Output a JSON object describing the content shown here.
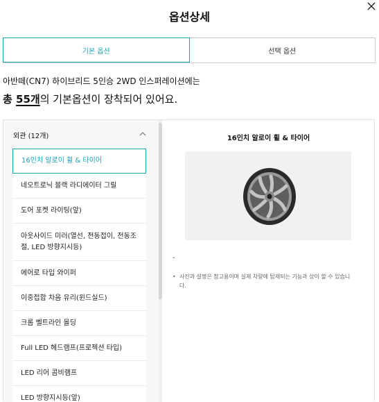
{
  "title": "옵션상세",
  "tabs": [
    {
      "label": "기본 옵션",
      "active": true
    },
    {
      "label": "선택 옵션",
      "active": false
    }
  ],
  "desc_line1": "아반떼(CN7) 하이브리드 5인승 2WD 인스퍼레이션에는",
  "desc_line2": {
    "prefix": "총 ",
    "count": "55개",
    "suffix": "의 기본옵션이 장착되어 있어요."
  },
  "category": {
    "label": "외관 (12개)"
  },
  "items": [
    "16인치 알로이 휠 & 타이어",
    "네오트로닉 블랙 라디에이터 그릴",
    "도어 포켓 라이팅(앞)",
    "아웃사이드 미러(열선, 전동접이, 전동조절, LED 방향지시등)",
    "에어로 타입 와이퍼",
    "이중접합 차음 유리(윈드실드)",
    "크롬 벨트라인 몰딩",
    "Full LED 헤드램프(프로젝션 타입)",
    "LED 리어 콤비램프",
    "LED 방향지시등(앞)"
  ],
  "detail": {
    "title": "16인치 알로이 휠 & 타이어",
    "dash": "-",
    "note": "사진과 설명은 참고용이며 실제 차량에 탑재되는 기능과 상이 할 수 있습니다."
  },
  "colors": {
    "accent": "#1fa3b6",
    "list_bg": "#f7f7f7",
    "image_bg": "#f1f1f1"
  },
  "icons": [
    "close-icon",
    "chevron-up-icon",
    "wheel-image"
  ]
}
